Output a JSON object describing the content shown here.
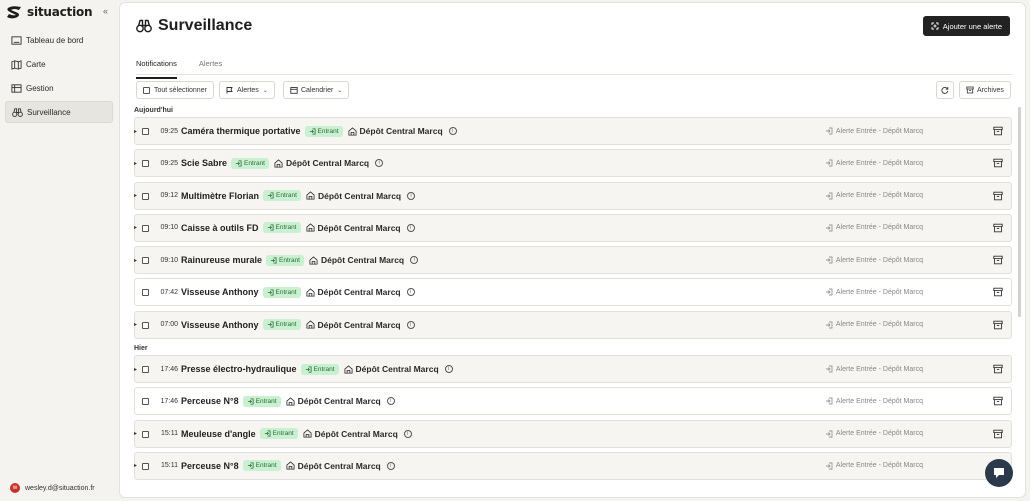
{
  "app": {
    "name": "situaction"
  },
  "sidebar": {
    "items": [
      {
        "label": "Tableau de bord",
        "icon": "dashboard-icon"
      },
      {
        "label": "Carte",
        "icon": "map-icon"
      },
      {
        "label": "Gestion",
        "icon": "list-icon"
      },
      {
        "label": "Surveillance",
        "icon": "binoculars-icon",
        "active": true
      }
    ],
    "user_email": "wesley.d@situaction.fr",
    "user_initial": "w"
  },
  "header": {
    "title": "Surveillance",
    "add_button": "Ajouter une alerte"
  },
  "tabs": [
    {
      "label": "Notifications",
      "active": true
    },
    {
      "label": "Alertes",
      "active": false
    }
  ],
  "toolbar": {
    "select_all": "Tout sélectionner",
    "alerts_filter": "Alertes",
    "calendar_filter": "Calendrier",
    "archives": "Archives"
  },
  "sections": [
    {
      "label": "Aujourd'hui",
      "rows": [
        {
          "time": "09:25",
          "name": "Caméra thermique portative",
          "badge": "Entrant",
          "place": "Dépôt Central Marcq",
          "alert": "Alerte Entrée - Dépôt Marcq",
          "expandable": true
        },
        {
          "time": "09:25",
          "name": "Scie Sabre",
          "badge": "Entrant",
          "place": "Dépôt Central Marcq",
          "alert": "Alerte Entrée - Dépôt Marcq",
          "expandable": true
        },
        {
          "time": "09:12",
          "name": "Multimètre Florian",
          "badge": "Entrant",
          "place": "Dépôt Central Marcq",
          "alert": "Alerte Entrée - Dépôt Marcq",
          "expandable": true
        },
        {
          "time": "09:10",
          "name": "Caisse à outils FD",
          "badge": "Entrant",
          "place": "Dépôt Central Marcq",
          "alert": "Alerte Entrée - Dépôt Marcq",
          "expandable": true
        },
        {
          "time": "09:10",
          "name": "Rainureuse murale",
          "badge": "Entrant",
          "place": "Dépôt Central Marcq",
          "alert": "Alerte Entrée - Dépôt Marcq",
          "expandable": true
        },
        {
          "time": "07:42",
          "name": "Visseuse Anthony",
          "badge": "Entrant",
          "place": "Dépôt Central Marcq",
          "alert": "Alerte Entrée - Dépôt Marcq",
          "expandable": false
        },
        {
          "time": "07:00",
          "name": "Visseuse Anthony",
          "badge": "Entrant",
          "place": "Dépôt Central Marcq",
          "alert": "Alerte Entrée - Dépôt Marcq",
          "expandable": true
        }
      ]
    },
    {
      "label": "Hier",
      "rows": [
        {
          "time": "17:46",
          "name": "Presse électro-hydraulique",
          "badge": "Entrant",
          "place": "Dépôt Central Marcq",
          "alert": "Alerte Entrée - Dépôt Marcq",
          "expandable": true
        },
        {
          "time": "17:46",
          "name": "Perceuse N°8",
          "badge": "Entrant",
          "place": "Dépôt Central Marcq",
          "alert": "Alerte Entrée - Dépôt Marcq",
          "expandable": false
        },
        {
          "time": "15:11",
          "name": "Meuleuse d'angle",
          "badge": "Entrant",
          "place": "Dépôt Central Marcq",
          "alert": "Alerte Entrée - Dépôt Marcq",
          "expandable": true
        },
        {
          "time": "15:11",
          "name": "Perceuse N°8",
          "badge": "Entrant",
          "place": "Dépôt Central Marcq",
          "alert": "Alerte Entrée - Dépôt Marcq",
          "expandable": true
        }
      ]
    }
  ],
  "colors": {
    "accent": "#222222",
    "badge_bg": "#c9f0d0",
    "badge_text": "#2d6b3a",
    "avatar": "#c7322b"
  }
}
